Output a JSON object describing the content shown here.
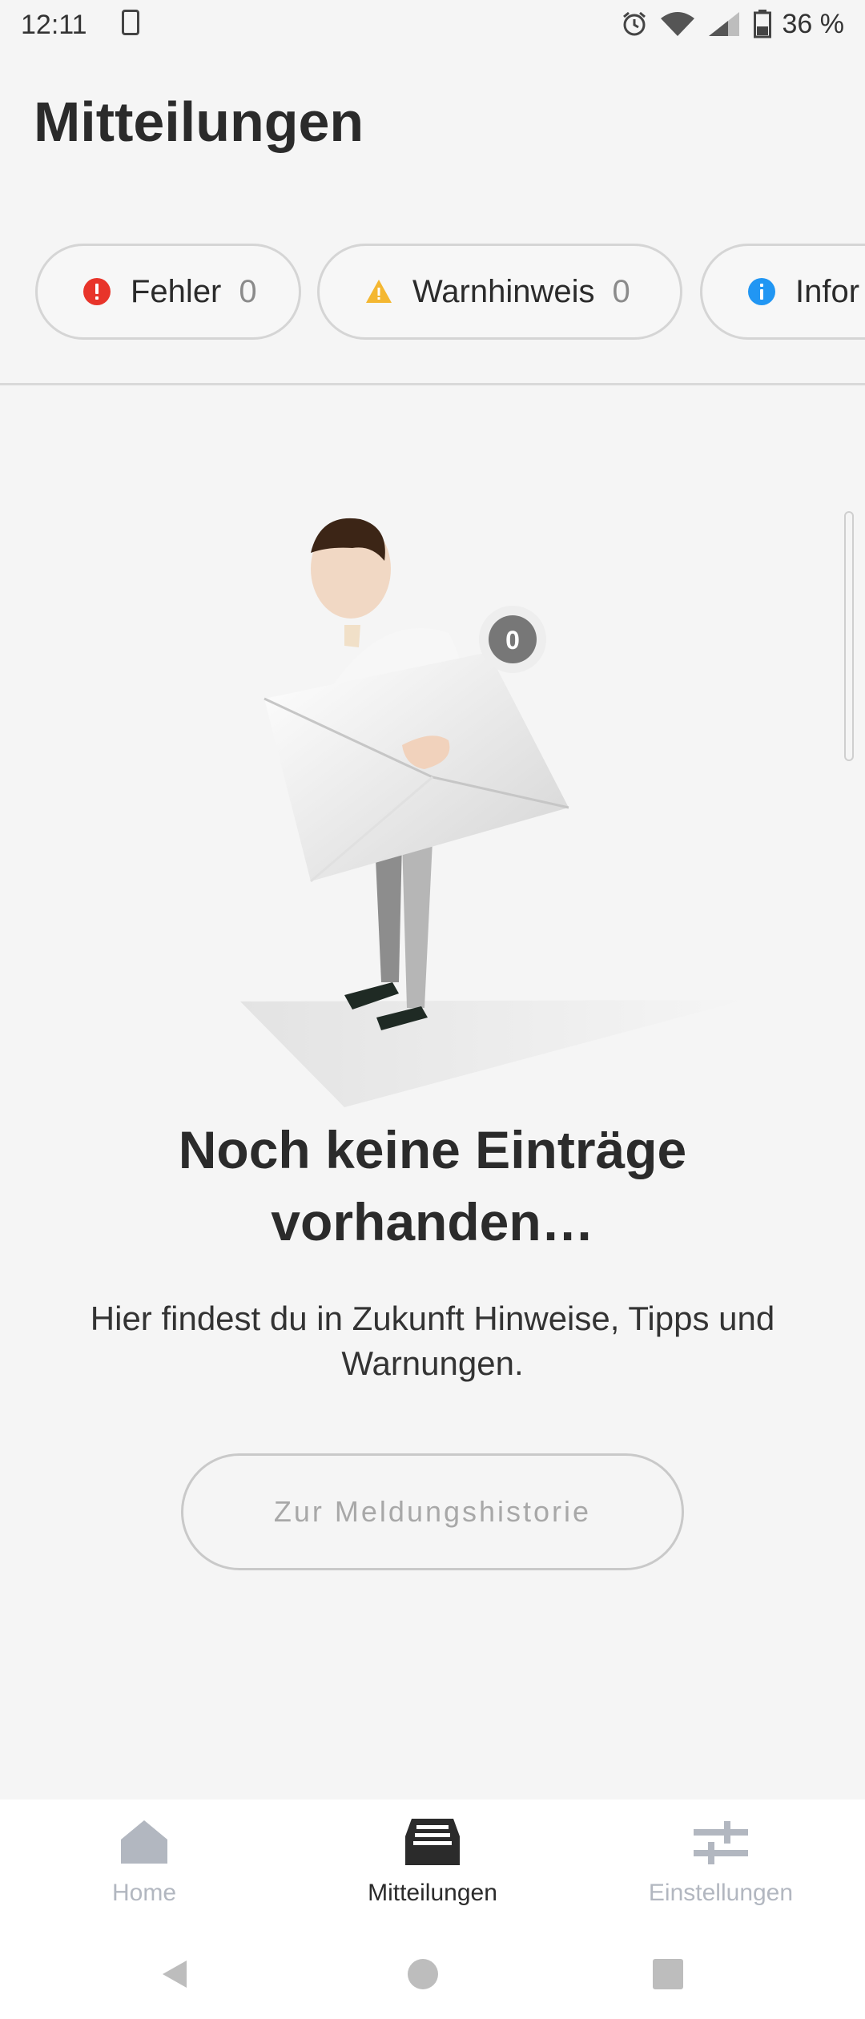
{
  "status_bar": {
    "time": "12:11",
    "battery": "36 %"
  },
  "page": {
    "title": "Mitteilungen"
  },
  "filters": [
    {
      "label": "Fehler",
      "count": "0",
      "color": "#e8342a"
    },
    {
      "label": "Warnhinweis",
      "count": "0",
      "color": "#f4b731"
    },
    {
      "label": "Infor",
      "color": "#2196f3"
    }
  ],
  "empty_state": {
    "badge_count": "0",
    "heading_line1": "Noch keine Einträge",
    "heading_line2": "vorhanden…",
    "body_line1": "Hier findest du in Zukunft Hinweise, Tipps und",
    "body_line2": "Warnungen.",
    "button_label": "Zur Meldungshistorie"
  },
  "bottom_nav": {
    "items": [
      {
        "label": "Home",
        "icon": "home-icon",
        "active": false
      },
      {
        "label": "Mitteilungen",
        "icon": "inbox-icon",
        "active": true
      },
      {
        "label": "Einstellungen",
        "icon": "sliders-icon",
        "active": false
      }
    ],
    "inactive_color": "#b2b7c0",
    "active_color": "#2b2b2b"
  },
  "system_nav": {
    "icons": [
      "back-icon",
      "home-circle-icon",
      "recents-icon"
    ]
  }
}
